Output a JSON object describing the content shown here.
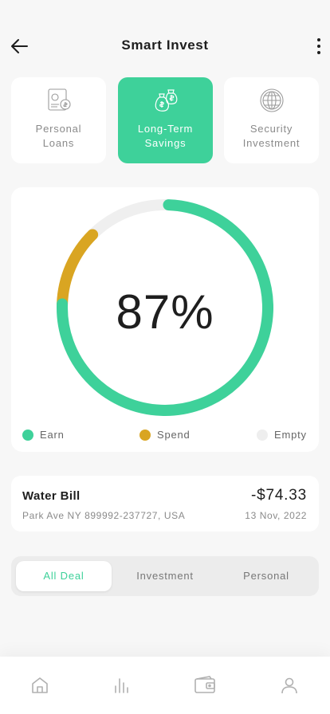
{
  "header": {
    "title": "Smart Invest"
  },
  "categories": [
    {
      "label": "Personal\nLoans",
      "icon": "loan-cash-icon",
      "active": false
    },
    {
      "label": "Long-Term\nSavings",
      "icon": "money-bags-icon",
      "active": true
    },
    {
      "label": "Security\nInvestment",
      "icon": "globe-icon",
      "active": false
    }
  ],
  "chart": {
    "percent_label": "87%",
    "legend": [
      {
        "label": "Earn",
        "color": "#3ed19a"
      },
      {
        "label": "Spend",
        "color": "#d9a522"
      },
      {
        "label": "Empty",
        "color": "#eeeeee"
      }
    ]
  },
  "chart_data": {
    "type": "pie",
    "categories": [
      "Earn",
      "Spend",
      "Empty"
    ],
    "values": [
      75,
      12,
      13
    ],
    "colors": [
      "#3ed19a",
      "#d9a522",
      "#efefef"
    ]
  },
  "bill": {
    "name": "Water Bill",
    "address": "Park Ave NY 899992-237727, USA",
    "amount": "-$74.33",
    "date": "13 Nov, 2022"
  },
  "tabs": [
    {
      "label": "All Deal",
      "active": true
    },
    {
      "label": "Investment",
      "active": false
    },
    {
      "label": "Personal",
      "active": false
    }
  ],
  "nav": [
    {
      "icon": "home-icon"
    },
    {
      "icon": "chart-icon"
    },
    {
      "icon": "wallet-icon"
    },
    {
      "icon": "profile-icon"
    }
  ],
  "colors": {
    "accent": "#3ed19a",
    "spend": "#d9a522",
    "empty": "#efefef"
  }
}
